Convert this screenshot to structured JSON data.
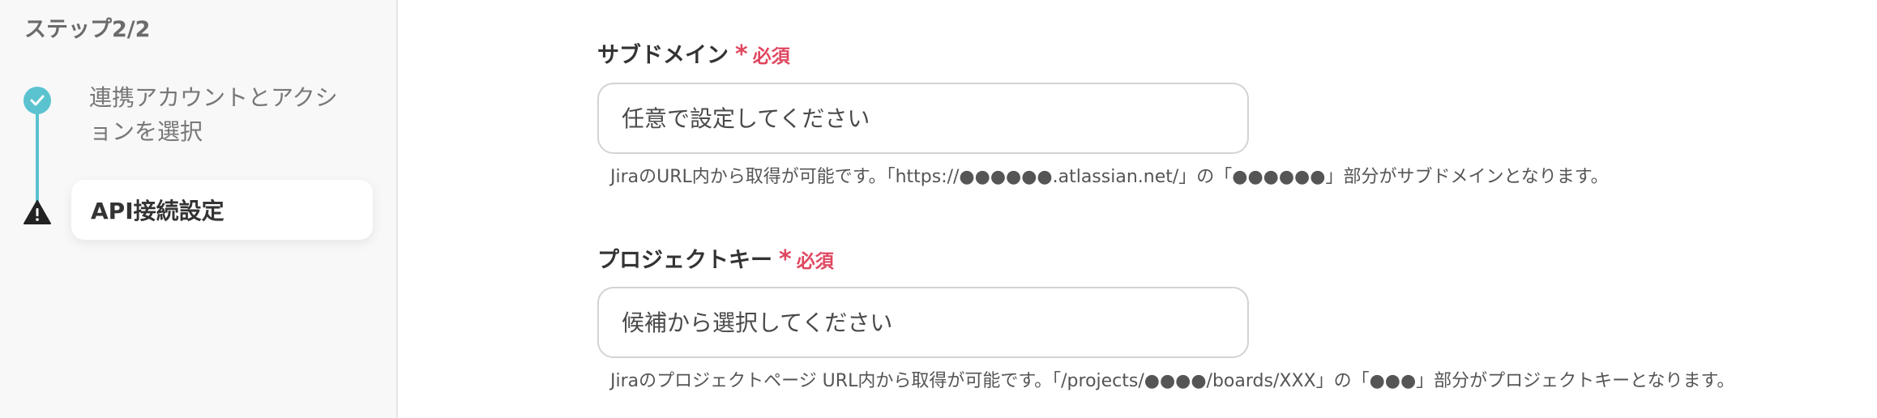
{
  "sidebar": {
    "step_title": "ステップ2/2",
    "steps": [
      {
        "label": "連携アカウントとアクションを選択",
        "status": "done"
      },
      {
        "label": "API接続設定",
        "status": "current-warning"
      }
    ],
    "accent_color": "#5ac3cf"
  },
  "form": {
    "required_label": "必須",
    "required_color": "#e0475f",
    "fields": [
      {
        "label": "サブドメイン",
        "asterisk": "*",
        "placeholder": "任意で設定してください",
        "help": "JiraのURL内から取得が可能です。「https://●●●●●●.atlassian.net/」の「●●●●●●」部分がサブドメインとなります。"
      },
      {
        "label": "プロジェクトキー",
        "asterisk": "*",
        "placeholder": "候補から選択してください",
        "help": "Jiraのプロジェクトページ URL内から取得が可能です。「/projects/●●●●/boards/XXX」の「●●●」部分がプロジェクトキーとなります。"
      }
    ]
  }
}
